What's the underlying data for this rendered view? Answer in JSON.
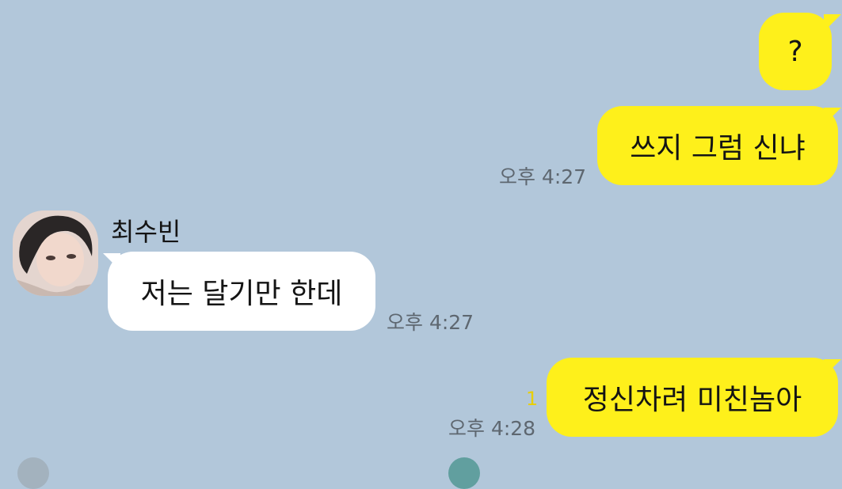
{
  "chat": {
    "messages": [
      {
        "side": "me",
        "text": "?",
        "time": ""
      },
      {
        "side": "me",
        "text": "쓰지 그럼 신냐",
        "time": "오후 4:27"
      },
      {
        "side": "other",
        "sender": "최수빈",
        "text": "저는 달기만 한데",
        "time": "오후 4:27"
      },
      {
        "side": "me",
        "text": "정신차려 미친놈아",
        "time": "오후 4:28",
        "unread": "1"
      }
    ]
  },
  "colors": {
    "background": "#b2c7da",
    "my_bubble": "#fef01b",
    "their_bubble": "#ffffff",
    "time_text": "#5e6770",
    "unread_count": "#e8cf00"
  }
}
